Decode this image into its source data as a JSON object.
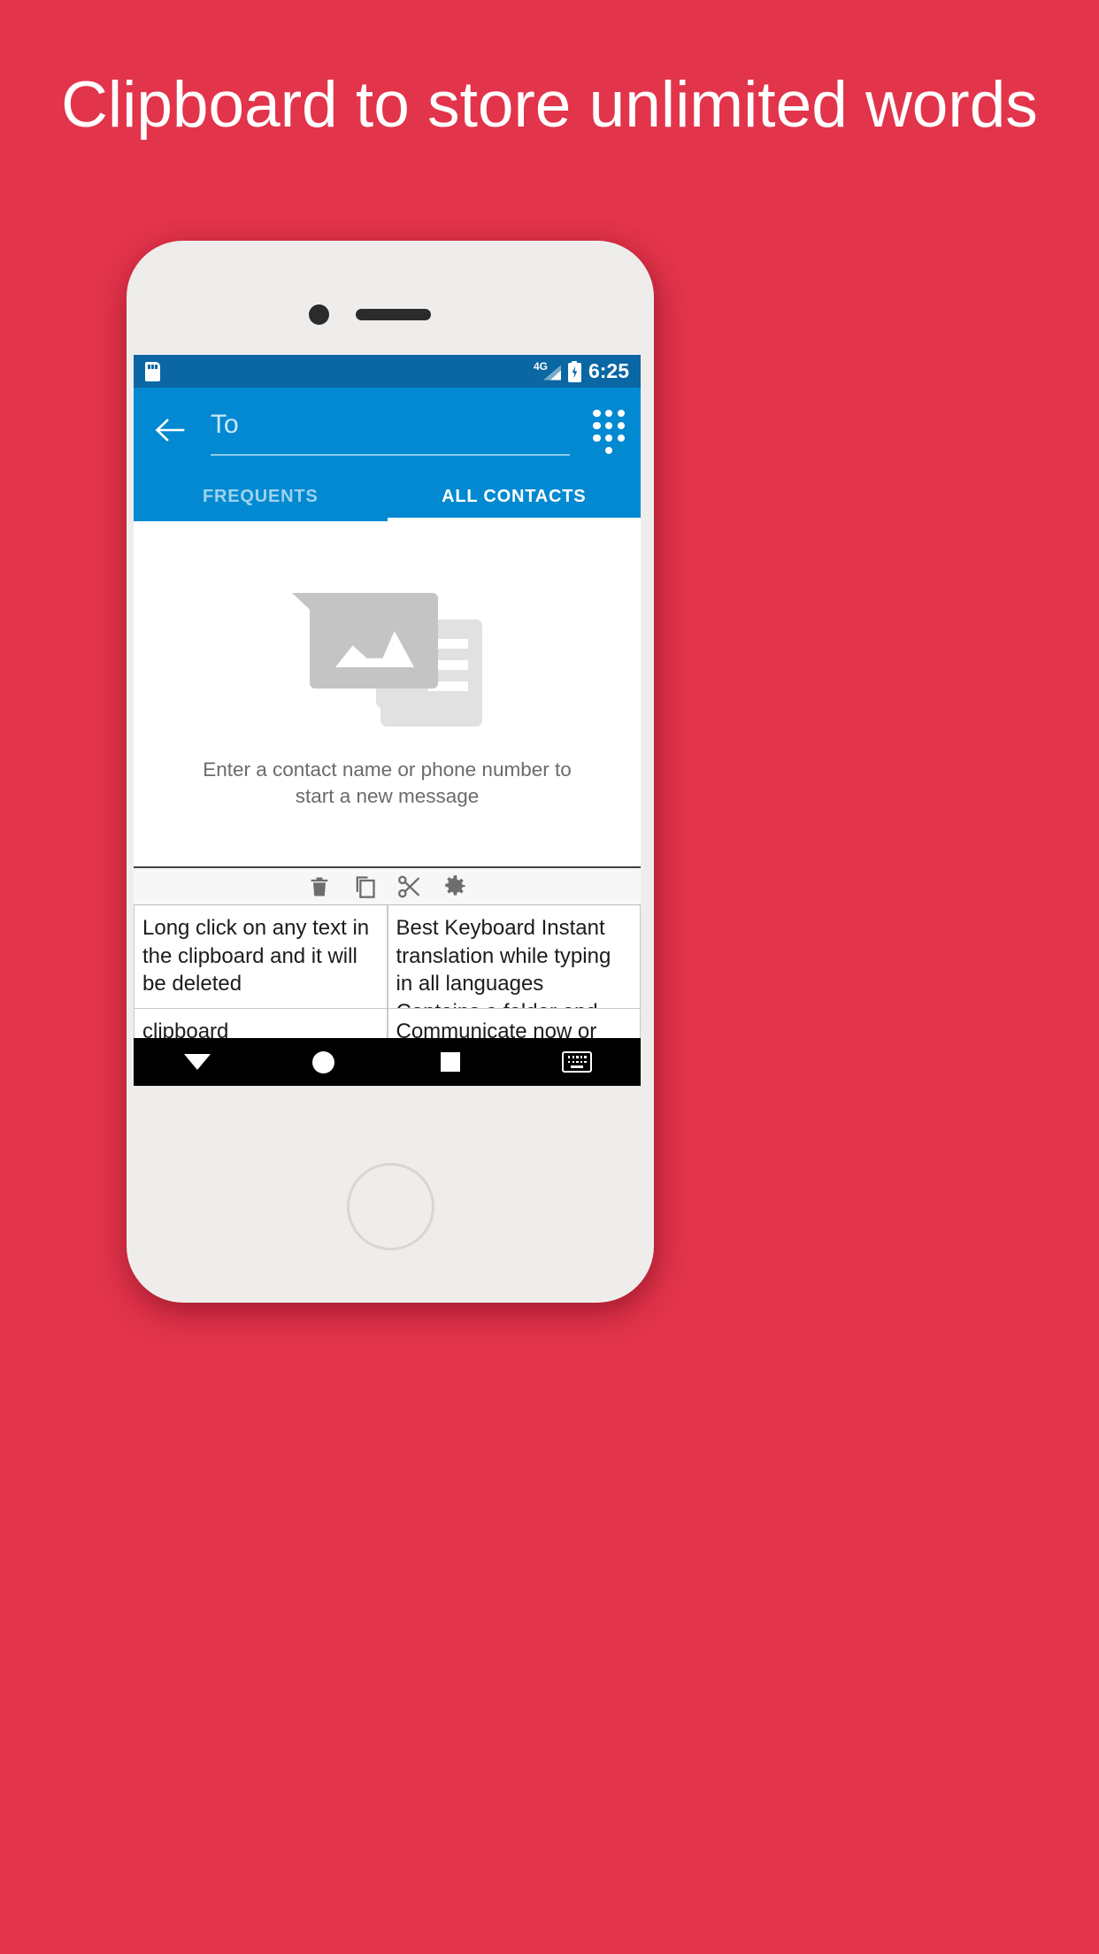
{
  "promo": {
    "headline": "Clipboard to store unlimited words",
    "background_color": "#E2344B",
    "text_color": "#FFFFFF"
  },
  "status_bar": {
    "sim_icon": "sim-card-icon",
    "network_label": "4G",
    "signal_icon": "signal-bars-icon",
    "battery_icon": "battery-charging-icon",
    "time": "6:25",
    "background_color": "#0A67A3"
  },
  "app_bar": {
    "back_icon": "back-arrow-icon",
    "recipient_placeholder": "To",
    "recipient_value": "",
    "dialpad_icon": "dialpad-icon",
    "background_color": "#0289D1"
  },
  "tabs": {
    "items": [
      {
        "label": "FREQUENTS",
        "active": false
      },
      {
        "label": "ALL CONTACTS",
        "active": true
      }
    ],
    "indicator_color": "#FFFFFF"
  },
  "empty_state": {
    "illustration_icon": "message-image-placeholder-icon",
    "message": "Enter a contact name or phone number to start a new message",
    "text_color": "#6B6B6B"
  },
  "clipboard": {
    "toolbar": [
      {
        "icon": "trash-icon",
        "label": "Delete"
      },
      {
        "icon": "copy-icon",
        "label": "Copy"
      },
      {
        "icon": "scissors-icon",
        "label": "Cut"
      },
      {
        "icon": "gear-icon",
        "label": "Settings"
      }
    ],
    "rows": [
      [
        "Long click on any text in the clipboard and it will be deleted",
        "Best Keyboard Instant translation while typing in all languages Contains a folder and emoji"
      ],
      [
        "clipboard",
        "Communicate now or speak any language you like with the Transboard keyboard. You can directly write and speak"
      ]
    ]
  },
  "nav_bar": {
    "items": [
      {
        "icon": "back-triangle-icon",
        "label": "Back"
      },
      {
        "icon": "home-circle-icon",
        "label": "Home"
      },
      {
        "icon": "recents-square-icon",
        "label": "Recents"
      },
      {
        "icon": "keyboard-icon",
        "label": "Keyboard"
      }
    ],
    "background_color": "#000000"
  }
}
